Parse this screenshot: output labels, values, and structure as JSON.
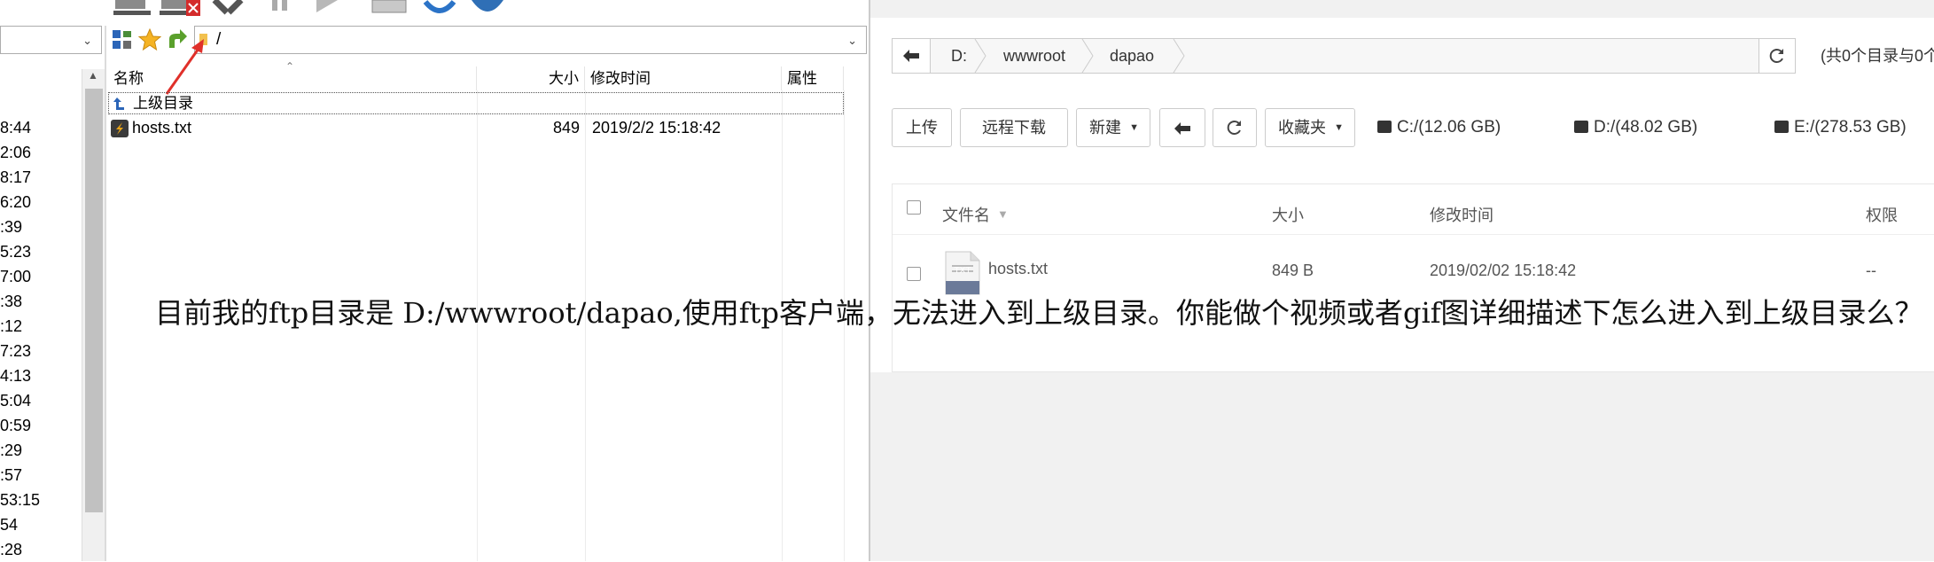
{
  "ftp": {
    "path_value": "/",
    "left_times": [
      "8:44",
      "2:06",
      "8:17",
      "6:20",
      ":39",
      "5:23",
      "7:00",
      ":38",
      ":12",
      "7:23",
      "4:13",
      "5:04",
      "0:59",
      ":29",
      ":57",
      "53:15",
      "54",
      ":28"
    ],
    "columns": {
      "name": "名称",
      "size": "大小",
      "modified": "修改时间",
      "attrs": "属性"
    },
    "parent_dir": "上级目录",
    "files": [
      {
        "name": "hosts.txt",
        "size": "849",
        "modified": "2019/2/2 15:18:42",
        "attrs": ""
      }
    ]
  },
  "web": {
    "breadcrumb": [
      "D:",
      "wwwroot",
      "dapao"
    ],
    "summary": "(共0个目录与0个",
    "buttons": {
      "upload": "上传",
      "remote_download": "远程下载",
      "new": "新建",
      "favorites": "收藏夹"
    },
    "disks": [
      "C:/(12.06 GB)",
      "D:/(48.02 GB)",
      "E:/(278.53 GB)"
    ],
    "columns": {
      "name": "文件名",
      "size": "大小",
      "modified": "修改时间",
      "perm": "权限"
    },
    "files": [
      {
        "name": "hosts.txt",
        "icon_label": "TXT",
        "size": "849 B",
        "modified": "2019/02/02 15:18:42",
        "perm": "--"
      }
    ]
  },
  "question": "目前我的ftp目录是 D:/wwwroot/dapao,使用ftp客户端，无法进入到上级目录。你能做个视频或者gif图详细描述下怎么进入到上级目录么？",
  "colors": {
    "accent_red": "#e0302a",
    "txt_icon": "#6b7a99",
    "ftp_file_icon": "#e8a317"
  },
  "icons": [
    "server-icon",
    "server-disconnect-icon",
    "cancel-icon",
    "pause-icon",
    "play-icon",
    "queue-icon",
    "refresh-icon",
    "globe-icon",
    "site-manager-icon",
    "star-icon",
    "up-arrow-icon",
    "folder-icon",
    "back-arrow-icon",
    "refresh-icon",
    "drive-icon",
    "txt-file-icon",
    "annotation-arrow"
  ]
}
